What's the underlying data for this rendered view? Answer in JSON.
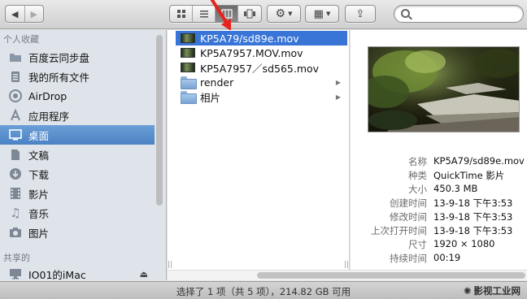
{
  "toolbar": {
    "back_glyph": "◀",
    "forward_glyph": "▶",
    "views": [
      "icon-view-icon",
      "list-view-icon",
      "column-view-icon",
      "cover-flow-icon"
    ],
    "active_view": 2,
    "action_glyph": "⚙",
    "arrange_glyph": "▦",
    "share_glyph": "⇪",
    "search_placeholder": ""
  },
  "sidebar": {
    "favorites_heading": "个人收藏",
    "items": [
      {
        "label": "百度云同步盘",
        "icon": "folder-icon"
      },
      {
        "label": "我的所有文件",
        "icon": "all-files-icon"
      },
      {
        "label": "AirDrop",
        "icon": "airdrop-icon"
      },
      {
        "label": "应用程序",
        "icon": "applications-icon"
      },
      {
        "label": "桌面",
        "icon": "desktop-icon",
        "selected": true
      },
      {
        "label": "文稿",
        "icon": "documents-icon"
      },
      {
        "label": "下载",
        "icon": "downloads-icon"
      },
      {
        "label": "影片",
        "icon": "movies-icon"
      },
      {
        "label": "音乐",
        "icon": "music-icon"
      },
      {
        "label": "图片",
        "icon": "pictures-icon"
      }
    ],
    "shared_heading": "共享的",
    "shared_items": [
      {
        "label": "IO01的iMac",
        "icon": "imac-icon",
        "eject_glyph": "⏏"
      }
    ]
  },
  "column": {
    "items": [
      {
        "label": "KP5A79/sd89e.mov",
        "type": "movie",
        "selected": true
      },
      {
        "label": "KP5A7957.MOV.mov",
        "type": "movie"
      },
      {
        "label": "KP5A7957／sd565.mov",
        "type": "movie"
      },
      {
        "label": "render",
        "type": "folder"
      },
      {
        "label": "相片",
        "type": "folder"
      }
    ]
  },
  "preview": {
    "info": [
      {
        "key": "名称",
        "value": "KP5A79/sd89e.mov"
      },
      {
        "key": "种类",
        "value": "QuickTime 影片"
      },
      {
        "key": "大小",
        "value": "450.3 MB"
      },
      {
        "key": "创建时间",
        "value": "13-9-18 下午3:53"
      },
      {
        "key": "修改时间",
        "value": "13-9-18 下午3:53"
      },
      {
        "key": "上次打开时间",
        "value": "13-9-18 下午3:53"
      },
      {
        "key": "尺寸",
        "value": "1920 × 1080"
      },
      {
        "key": "持续时间",
        "value": "00:19"
      }
    ]
  },
  "status": {
    "text": "选择了 1 项（共 5 项），214.82 GB 可用",
    "watermark": "影视工业网",
    "watermark_glyph": "✺"
  },
  "colors": {
    "selection": "#3875d7",
    "sidebar_selection": "#4c82c4",
    "annotation_arrow": "#e8211a"
  }
}
